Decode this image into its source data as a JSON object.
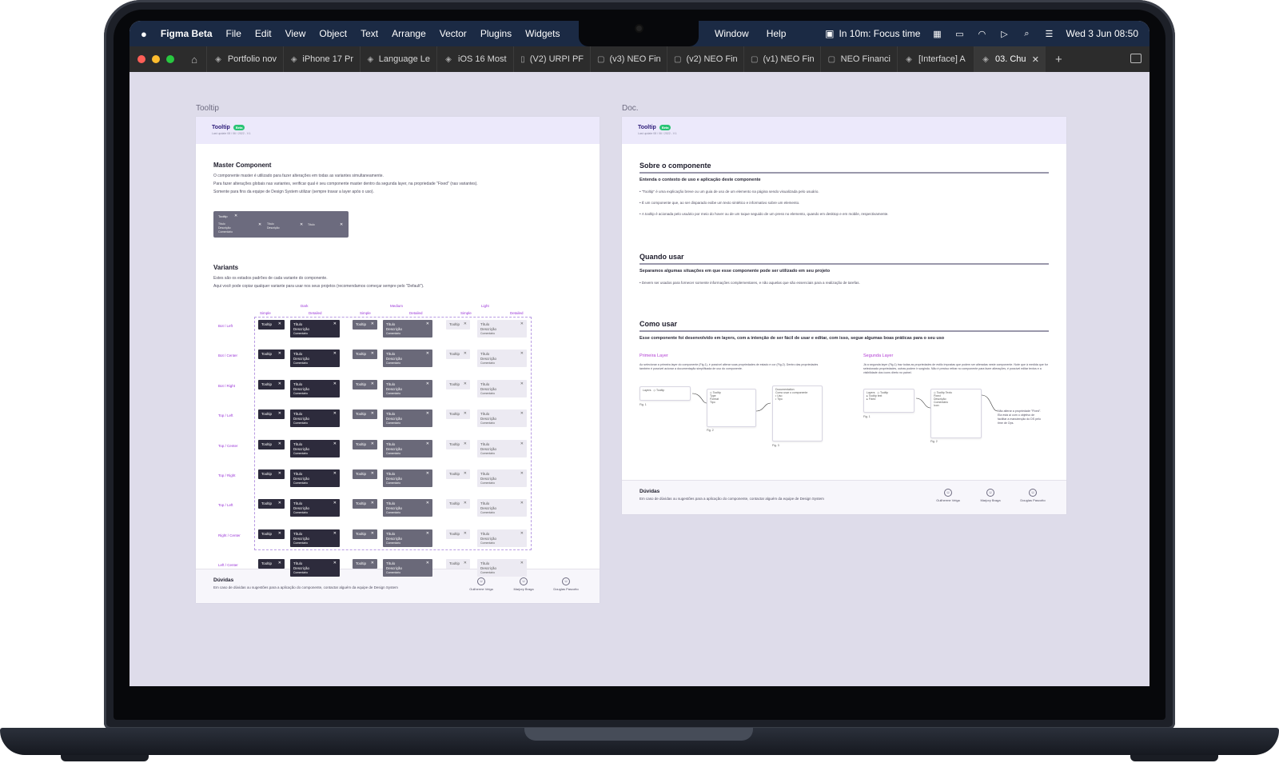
{
  "menubar": {
    "app_name": "Figma Beta",
    "menus": [
      "File",
      "Edit",
      "View",
      "Object",
      "Text",
      "Arrange",
      "Vector",
      "Plugins",
      "Widgets"
    ],
    "menus_right": [
      "Window",
      "Help"
    ],
    "focus": "In 10m: Focus time",
    "datetime": "Wed 3 Jun  08:50"
  },
  "tabs": [
    {
      "label": "Portfolio nov",
      "icon": "figma-file-icon"
    },
    {
      "label": "iPhone 17 Pr",
      "icon": "figma-file-icon"
    },
    {
      "label": "Language Le",
      "icon": "figma-file-icon"
    },
    {
      "label": "iOS 16 Most",
      "icon": "figma-file-icon"
    },
    {
      "label": "(V2) URPI PF",
      "icon": "book-icon"
    },
    {
      "label": "(v3) NEO Fin",
      "icon": "jam-icon"
    },
    {
      "label": "(v2) NEO Fin",
      "icon": "jam-icon"
    },
    {
      "label": "(v1) NEO Fin",
      "icon": "jam-icon"
    },
    {
      "label": "NEO Financi",
      "icon": "jam-icon"
    },
    {
      "label": "[Interface] A",
      "icon": "figma-file-icon"
    }
  ],
  "active_tab": {
    "label": "03. Chu"
  },
  "frames": {
    "tooltip_label": "Tooltip",
    "doc_label": "Doc.",
    "header_title": "Tooltip",
    "header_badge": "Beta",
    "header_sub": "Last update 08 / 06 / 2022 - V.1"
  },
  "tooltip_frame": {
    "master_title": "Master Component",
    "master_lines": [
      "O componente master é utilizado para fazer alterações em todas as variantes simultaneamente.",
      "Para fazer alterações globais nas variantes, verificar qual é seu componente master dentro da segunda layer, na propriedade \"Fixed\" (nas variantes).",
      "Somente para fins da equipe de Design System utilizar (sempre travar a layer após o uso)."
    ],
    "variants_title": "Variants",
    "variants_lines": [
      "Estes são os estados padrões de cada variante do componente.",
      "Aqui você pode copiar qualquer variante para usar nos seus projetos (recomendamos começar sempre pelo \"Default\")."
    ],
    "groups": [
      "Dark",
      "Medium",
      "Light"
    ],
    "sub_cols": [
      "Simple",
      "Detailed",
      "Simple",
      "Detailed",
      "Simple",
      "Detailed"
    ],
    "rows": [
      "Bot / Left",
      "Bot / Center",
      "Bot / Right",
      "Top / Left",
      "Top / Center",
      "Top / Right",
      "Top / Left",
      "Right / Center",
      "Left / Center"
    ],
    "tooltip_text": "Tooltip",
    "detailed_title": "Título",
    "detailed_desc": "Descrição",
    "detailed_meta": "Comentário"
  },
  "doc_frame": {
    "s1_title": "Sobre o componente",
    "s1_sub": "Entenda o contexto de uso e aplicação deste componente",
    "s1_bullets": [
      "\"Tooltip\" é uma explicação breve ou um guia de uso de um elemento na página sendo visualizada pelo usuário.",
      "É um componente que, ao ser disparado exibe um texto sintético e informativo sobre um elemento.",
      "A tooltip é acionada pelo usuário por meio do hover ou de um toque seguido de um press no elemento, quando em desktop e em mobile, respectivamente."
    ],
    "s2_title": "Quando usar",
    "s2_sub": "Separamos algumas situações em que esse componente pode ser utilizado em seu projeto",
    "s2_bullets": [
      "Devem ser usados para fornecer somente informações complementares, e não aquelas que são essenciais para a realização de tarefas."
    ],
    "s3_title": "Como usar",
    "s3_sub": "Esse componente foi desenvolvido em layers, com a intenção de ser fácil de usar e editar, com isso, segue algumas boas práticas para o seu uso",
    "col1_title": "Primeira Layer",
    "col1_text": "Ao selecionar a primeira layer do componente (Fig.1), é possível alterar suas propriedades de estado e cor (Fig.2). Dentro das propriedades também é possível acionar a documentação simplificada de uso do componente.",
    "col2_title": "Segunda Layer",
    "col2_text": "Já a segunda layer (Fig.1) traz todas as propriedades de estilo impostas que podem ser alteradas neste componente. Note que à medida que for selecionado propriedades, outras podem ir surgindo. Não é preciso retirar no componente para fazer alterações, é possível editar textos e a visibilidade dos ícons direto no painel.",
    "note": "Não alterar a propriedade \"Fixed\". Ela está aí com o objetivo de facilitar a manutenção do DS pelo time de Ops.",
    "fig1": "Fig. 1",
    "fig2": "Fig. 2",
    "fig3": "Fig. 3"
  },
  "footer": {
    "title": "Dúvidas",
    "desc": "Em caso de dúvidas ou sugestões para a aplicação do componente, contactar alguém da equipe de Design System",
    "people": [
      "Guilherme Veiga",
      "Marjory Braga",
      "Douglas Pascotto"
    ]
  },
  "colors": {
    "menubar": "#1b2a44",
    "canvas": "#dedcea",
    "accent_purple": "#9a34d8",
    "badge_green": "#29c474"
  }
}
